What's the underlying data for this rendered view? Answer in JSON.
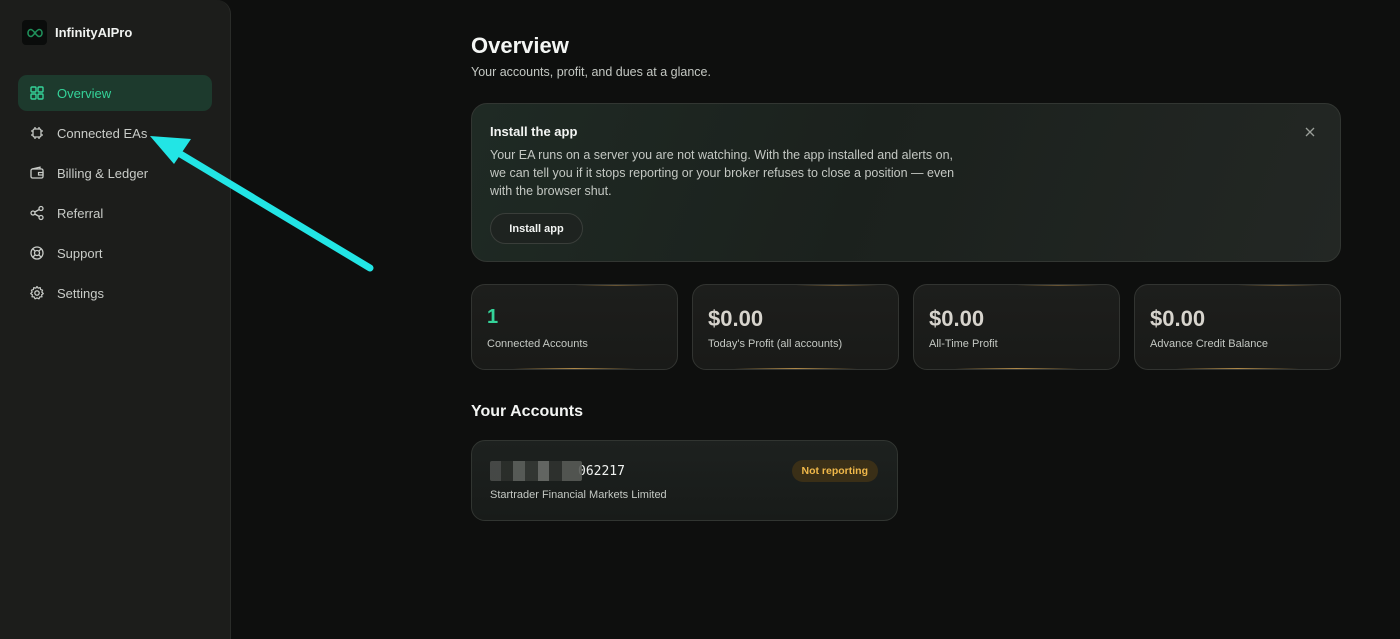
{
  "brand": {
    "name": "InfinityAIPro",
    "logo_icon": "infinity-icon"
  },
  "sidebar": {
    "items": [
      {
        "label": "Overview",
        "icon": "grid-icon",
        "active": true
      },
      {
        "label": "Connected EAs",
        "icon": "chip-icon",
        "active": false
      },
      {
        "label": "Billing & Ledger",
        "icon": "wallet-icon",
        "active": false
      },
      {
        "label": "Referral",
        "icon": "share-icon",
        "active": false
      },
      {
        "label": "Support",
        "icon": "lifebuoy-icon",
        "active": false
      },
      {
        "label": "Settings",
        "icon": "gear-icon",
        "active": false
      }
    ]
  },
  "header": {
    "title": "Overview",
    "subtitle": "Your accounts, profit, and dues at a glance."
  },
  "install_banner": {
    "title": "Install the app",
    "text": "Your EA runs on a server you are not watching. With the app installed and alerts on, we can tell you if it stops reporting or your broker refuses to close a position — even with the browser shut.",
    "button_label": "Install app",
    "close_icon": "close-icon"
  },
  "stats": [
    {
      "value": "1",
      "label": "Connected Accounts"
    },
    {
      "value": "$0.00",
      "label": "Today's Profit (all accounts)"
    },
    {
      "value": "$0.00",
      "label": "All-Time Profit"
    },
    {
      "value": "$0.00",
      "label": "Advance Credit Balance"
    }
  ],
  "accounts_section": {
    "title": "Your Accounts",
    "accounts": [
      {
        "id_suffix": "062217",
        "broker": "Startrader Financial Markets Limited",
        "status": "Not reporting"
      }
    ]
  },
  "colors": {
    "accent": "#34d399",
    "annotation_arrow": "#22e5e5",
    "status_warning": "#f0b84a"
  }
}
